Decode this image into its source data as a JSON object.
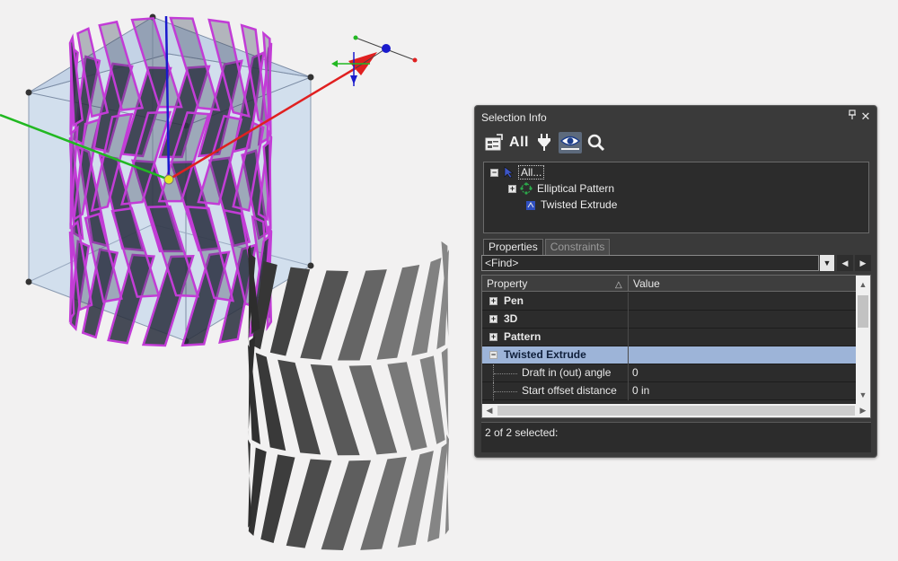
{
  "panel": {
    "title": "Selection Info",
    "pin_icon": "pin-icon",
    "close_icon": "close-icon"
  },
  "toolbar": {
    "all_label": "All",
    "buttons": [
      "properties-icon",
      "all-button",
      "filter-plug-icon",
      "eye-view-icon",
      "magnifier-icon"
    ],
    "active": "eye-view-icon"
  },
  "tree": {
    "items": [
      {
        "label": "All...",
        "icon": "selection-arrow-icon",
        "expanded": true
      },
      {
        "label": "Elliptical Pattern",
        "icon": "pattern-icon",
        "expanded": false
      },
      {
        "label": "Twisted Extrude",
        "icon": "extrude-icon"
      }
    ]
  },
  "tabs": [
    {
      "label": "Properties",
      "active": true
    },
    {
      "label": "Constraints",
      "active": false
    }
  ],
  "find": {
    "value": "<Find>"
  },
  "grid": {
    "headers": {
      "property": "Property",
      "value": "Value"
    },
    "rows": [
      {
        "name": "Pen",
        "value": "",
        "group": true,
        "expanded": false
      },
      {
        "name": "3D",
        "value": "",
        "group": true,
        "expanded": false
      },
      {
        "name": "Pattern",
        "value": "",
        "group": true,
        "expanded": false
      },
      {
        "name": "Twisted Extrude",
        "value": "",
        "group": true,
        "expanded": true,
        "selected": true
      },
      {
        "name": "Draft in (out) angle",
        "value": "0",
        "group": false
      },
      {
        "name": "Start offset distance",
        "value": "0 in",
        "group": false
      }
    ]
  },
  "status": {
    "text": "2 of 2 selected:"
  },
  "colors": {
    "panel_bg": "#3a3a3a",
    "selection_highlight": "#9db4d8",
    "wireframe_magenta": "#c23cd6",
    "axis_x_red": "#e02020",
    "axis_y_green": "#22b822",
    "axis_z_blue": "#1a1acc",
    "bounding_box_fill": "#c4d6ea"
  }
}
